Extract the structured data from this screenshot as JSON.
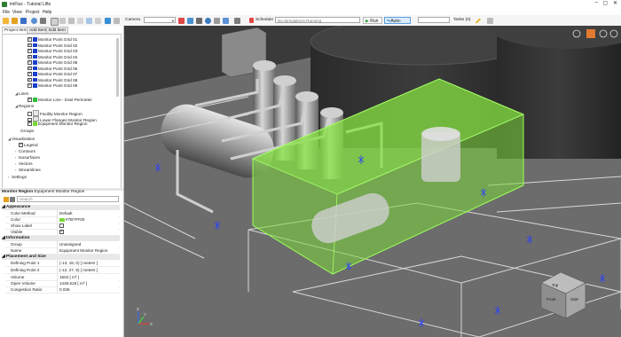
{
  "window": {
    "title": "imFlux - Tutorial Lifts"
  },
  "menu": [
    "File",
    "View",
    "Project",
    "Help"
  ],
  "toolbar": {
    "camera_label": "Camera",
    "schedule_label": "Schedule",
    "simulation_placeholder": "No Simulations Running",
    "run_label": "Run",
    "autolink_label": "Auto-Link",
    "tasks_label": "Tasks (0)"
  },
  "left_panel": {
    "tabs": [
      "Project Items",
      "Add Item",
      "Edit Item"
    ],
    "grid_items": [
      "Monitor Point Grid 01",
      "Monitor Point Grid 02",
      "Monitor Point Grid 03",
      "Monitor Point Grid 04",
      "Monitor Point Grid 05",
      "Monitor Point Grid 06",
      "Monitor Point Grid 07",
      "Monitor Point Grid 08",
      "Monitor Point Grid 09"
    ],
    "lines_label": "Lines",
    "line_item": "Monitor Line - East Perimeter",
    "regions_label": "Regions",
    "regions": [
      "Facility Monitor Region",
      "Lower Flanges Monitor Region",
      "Equipment Monitor Region"
    ],
    "groups_label": "Groups",
    "visualization_label": "Visualization",
    "visualization_items": [
      "Legend",
      "Contours",
      "Isosurfaces",
      "Vectors",
      "Streamlines"
    ],
    "settings_label": "Settings"
  },
  "properties": {
    "header_kind": "Monitor Region",
    "header_name": "Equipment Monitor Region",
    "search_placeholder": "Search",
    "appearance_label": "Appearance",
    "color_method_key": "Color Method",
    "color_method_val": "Default",
    "color_key": "Color",
    "color_val": "#7B7FF00",
    "show_label_key": "Show Label",
    "visible_key": "Visible",
    "information_label": "Information",
    "group_key": "Group",
    "group_val": "Unassigned",
    "name_key": "Name",
    "name_val": "Equipment Monitor Region",
    "placement_label": "Placement and Size",
    "dp1_key": "Defining Point 1",
    "dp1_val": "(-13, 18, 0) [ meters ]",
    "dp2_key": "Defining Point 2",
    "dp2_val": "(-12, 27, 8) [ meters ]",
    "volume_key": "Volume",
    "volume_val": "1504 [ m³ ]",
    "open_volume_key": "Open Volume",
    "open_volume_val": "1449.518 [ m³ ]",
    "congestion_key": "Congestion Ratio",
    "congestion_val": "0.036"
  },
  "viewport": {
    "cube_top": "Top",
    "cube_front": "Front",
    "cube_side": "Side",
    "axis_x": "X",
    "axis_y": "Y",
    "axis_z": "Z"
  },
  "colors": {
    "region_fill": "#7bd83a",
    "accent": "#3a8fd4"
  }
}
